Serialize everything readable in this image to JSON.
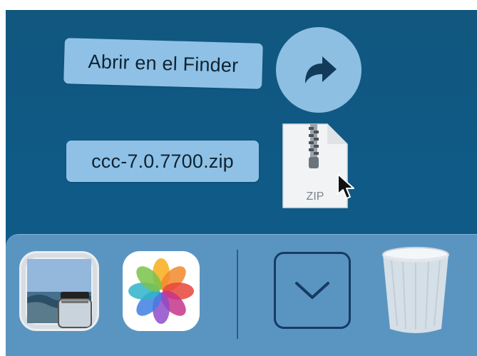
{
  "drag_actions": {
    "open_in_finder_label": "Abrir en el Finder",
    "open_button_icon": "share-arrow-icon"
  },
  "dragged_file": {
    "name": "ccc-7.0.7700.zip",
    "type_label": "ZIP",
    "icon": "zip-file-icon"
  },
  "dock": {
    "items": [
      {
        "name": "preview-app-icon"
      },
      {
        "name": "photos-app-icon"
      },
      {
        "name": "downloads-stack",
        "icon": "chevron-down-icon"
      },
      {
        "name": "trash-icon"
      }
    ]
  },
  "colors": {
    "desktop": "#0f5a86",
    "label_bg": "#8fc1e6",
    "dock_bg": "#5a95c1",
    "stack_border": "#163b63"
  }
}
